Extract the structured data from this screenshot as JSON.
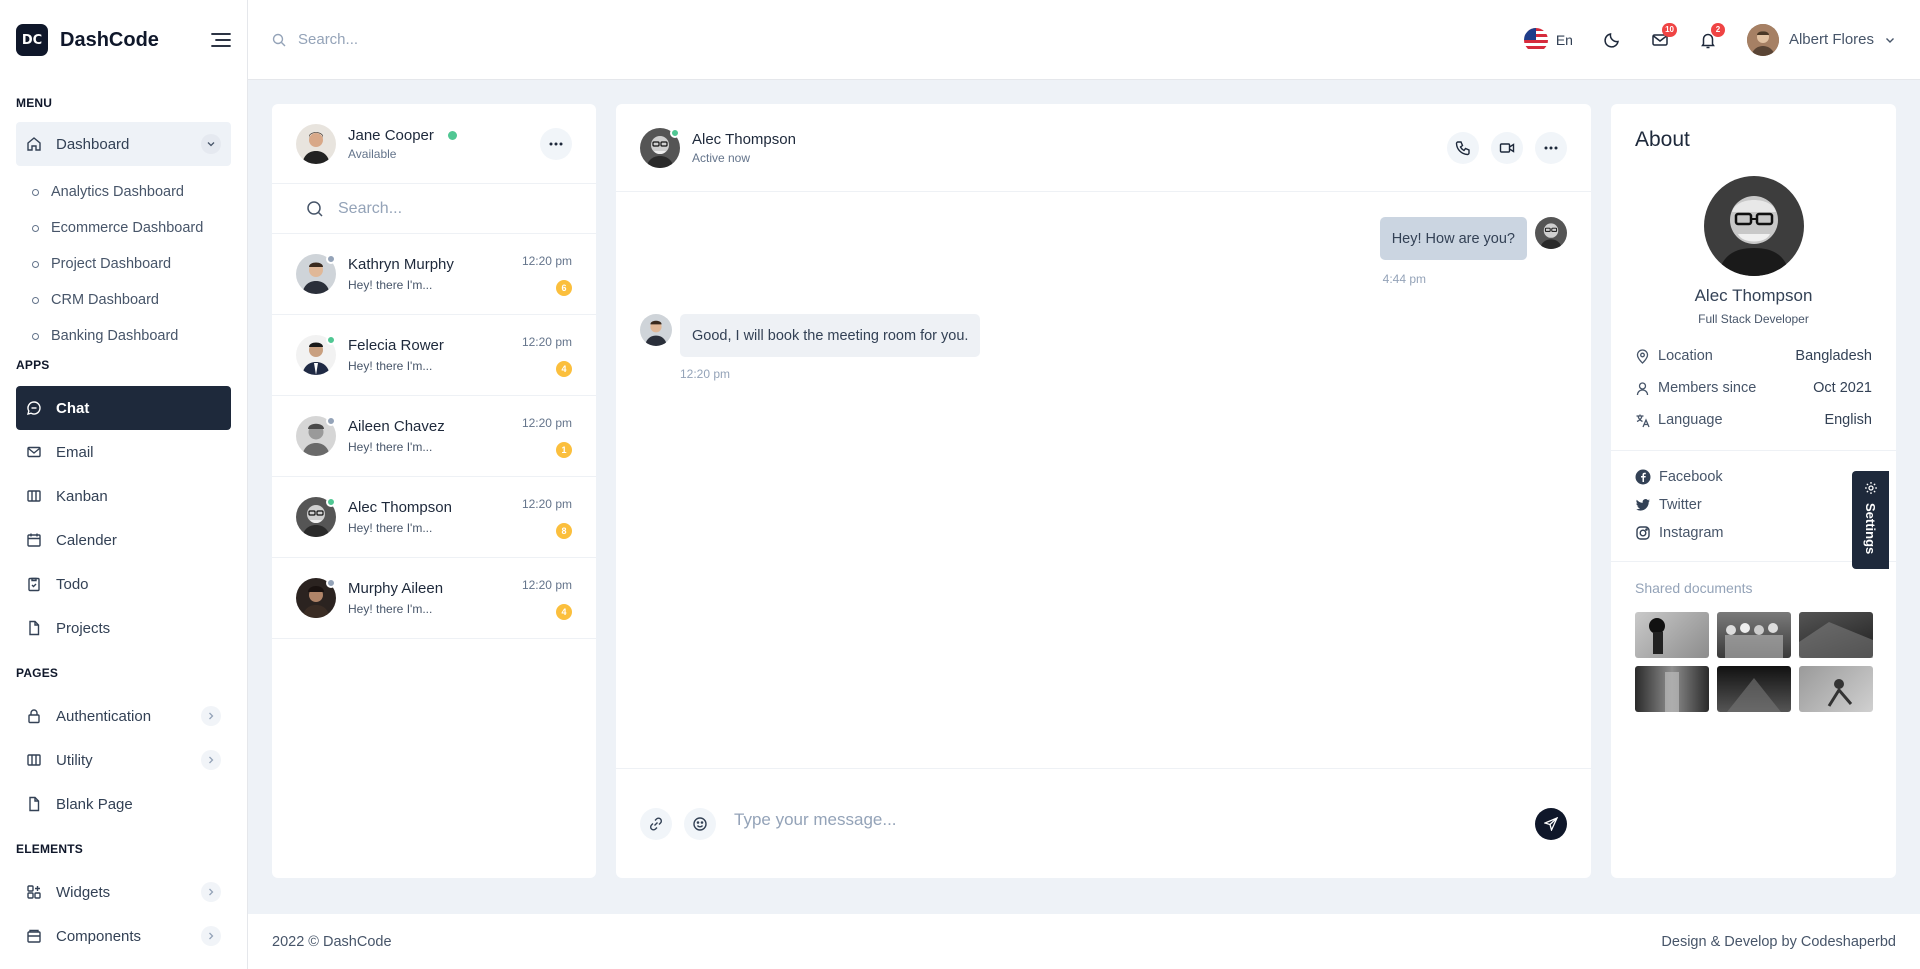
{
  "brand": {
    "name": "DashCode",
    "logo_text": "DC"
  },
  "sidebar": {
    "menu_label": "MENU",
    "dashboard_label": "Dashboard",
    "dashboard_items": [
      "Analytics Dashboard",
      "Ecommerce Dashboard",
      "Project Dashboard",
      "CRM Dashboard",
      "Banking Dashboard"
    ],
    "apps_label": "APPS",
    "apps": [
      {
        "label": "Chat",
        "icon": "message-circle-icon"
      },
      {
        "label": "Email",
        "icon": "mail-icon"
      },
      {
        "label": "Kanban",
        "icon": "kanban-icon"
      },
      {
        "label": "Calender",
        "icon": "calendar-icon"
      },
      {
        "label": "Todo",
        "icon": "clipboard-icon"
      },
      {
        "label": "Projects",
        "icon": "file-icon"
      }
    ],
    "pages_label": "PAGES",
    "pages": [
      {
        "label": "Authentication",
        "icon": "lock-icon"
      },
      {
        "label": "Utility",
        "icon": "columns-icon"
      },
      {
        "label": "Blank Page",
        "icon": "file-icon"
      }
    ],
    "elements_label": "ELEMENTS",
    "elements": [
      {
        "label": "Widgets",
        "icon": "widgets-icon"
      },
      {
        "label": "Components",
        "icon": "box-icon"
      }
    ]
  },
  "header": {
    "search_placeholder": "Search...",
    "language": "En",
    "mail_badge": "10",
    "notification_badge": "2",
    "user_name": "Albert Flores"
  },
  "contacts_panel": {
    "me": {
      "name": "Jane Cooper",
      "status": "Available"
    },
    "search_placeholder": "Search...",
    "contacts": [
      {
        "name": "Kathryn Murphy",
        "preview": "Hey! there I'm...",
        "time": "12:20 pm",
        "count": "6"
      },
      {
        "name": "Felecia Rower",
        "preview": "Hey! there I'm...",
        "time": "12:20 pm",
        "count": "4"
      },
      {
        "name": "Aileen Chavez",
        "preview": "Hey! there I'm...",
        "time": "12:20 pm",
        "count": "1"
      },
      {
        "name": "Alec Thompson",
        "preview": "Hey! there I'm...",
        "time": "12:20 pm",
        "count": "8"
      },
      {
        "name": "Murphy Aileen",
        "preview": "Hey! there I'm...",
        "time": "12:20 pm",
        "count": "4"
      }
    ]
  },
  "chat": {
    "contact_name": "Alec Thompson",
    "contact_status": "Active now",
    "messages": [
      {
        "direction": "out",
        "text": "Hey! How are you?",
        "time": "4:44 pm"
      },
      {
        "direction": "in",
        "text": "Good, I will book the meeting room for you.",
        "time": "12:20 pm"
      }
    ],
    "composer_placeholder": "Type your message..."
  },
  "about": {
    "title": "About",
    "name": "Alec Thompson",
    "role": "Full Stack Developer",
    "info": [
      {
        "label": "Location",
        "value": "Bangladesh",
        "icon": "map-pin-icon"
      },
      {
        "label": "Members since",
        "value": "Oct 2021",
        "icon": "user-icon"
      },
      {
        "label": "Language",
        "value": "English",
        "icon": "translate-icon"
      }
    ],
    "socials": [
      {
        "label": "Facebook",
        "icon": "facebook-icon"
      },
      {
        "label": "Twitter",
        "icon": "twitter-icon"
      },
      {
        "label": "Instagram",
        "icon": "instagram-icon"
      }
    ],
    "shared_label": "Shared documents",
    "settings_tab": "Settings"
  },
  "footer": {
    "left": "2022 © DashCode",
    "right": "Design & Develop by Codeshaperbd"
  },
  "colors": {
    "primary_dark": "#1e293b",
    "online": "#50c793",
    "away": "#94a3b8",
    "badge_yellow": "#fbbf3d",
    "badge_red": "#ef4444"
  }
}
